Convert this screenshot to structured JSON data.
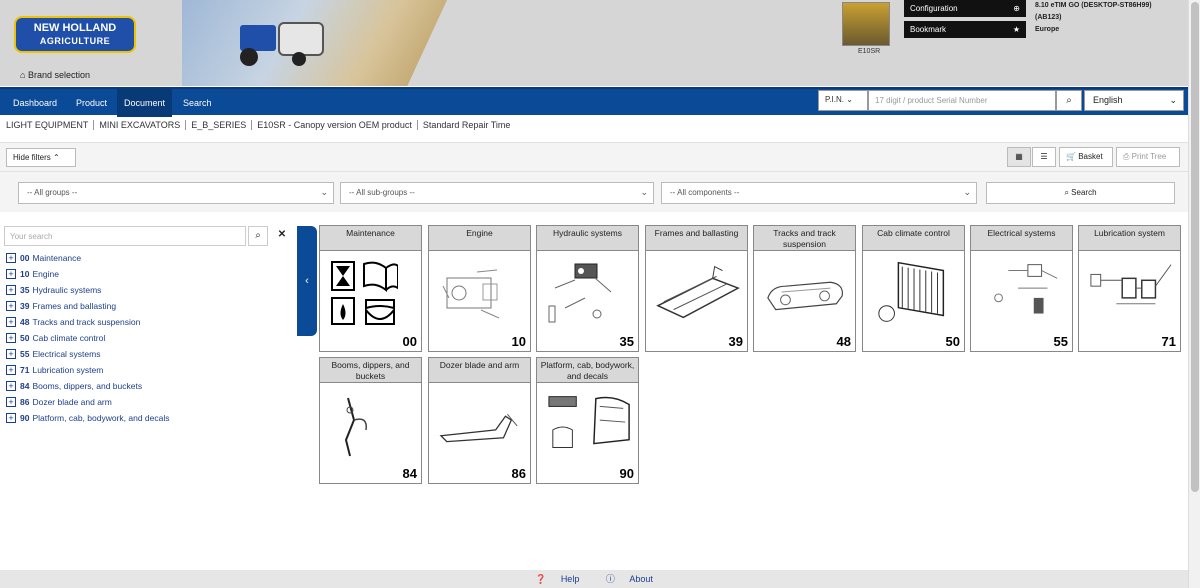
{
  "header": {
    "logo_line1": "NEW HOLLAND",
    "logo_line2": "AGRICULTURE",
    "brand_selection": "Brand selection",
    "machine_caption": "E10SR",
    "config_label": "Configuration",
    "bookmark_label": "Bookmark",
    "session_line1": "8.10 eTIM GO (DESKTOP-ST86H99)",
    "session_line2": "(AB123)",
    "session_line3": "Europe"
  },
  "nav": {
    "items": [
      {
        "label": "Dashboard"
      },
      {
        "label": "Product"
      },
      {
        "label": "Document"
      },
      {
        "label": "Search"
      }
    ],
    "pin_label": "P.I.N.",
    "serial_placeholder": "17 digit / product Serial Number",
    "language": "English"
  },
  "breadcrumb": [
    "LIGHT EQUIPMENT",
    "MINI EXCAVATORS",
    "E_B_SERIES",
    "E10SR - Canopy version OEM product",
    "Standard Repair Time"
  ],
  "toolbar": {
    "hide_filters": "Hide filters",
    "basket": "Basket",
    "print_tree": "Print Tree"
  },
  "filters": {
    "groups": "-- All groups --",
    "subgroups": "-- All sub-groups --",
    "components": "-- All components --",
    "search": "Search"
  },
  "tree": {
    "search_placeholder": "Your search",
    "items": [
      {
        "code": "00",
        "label": "Maintenance"
      },
      {
        "code": "10",
        "label": "Engine"
      },
      {
        "code": "35",
        "label": "Hydraulic systems"
      },
      {
        "code": "39",
        "label": "Frames and ballasting"
      },
      {
        "code": "48",
        "label": "Tracks and track suspension"
      },
      {
        "code": "50",
        "label": "Cab climate control"
      },
      {
        "code": "55",
        "label": "Electrical systems"
      },
      {
        "code": "71",
        "label": "Lubrication system"
      },
      {
        "code": "84",
        "label": "Booms, dippers, and buckets"
      },
      {
        "code": "86",
        "label": "Dozer blade and arm"
      },
      {
        "code": "90",
        "label": "Platform, cab, bodywork, and decals"
      }
    ]
  },
  "tiles": [
    {
      "title": "Maintenance",
      "num": "00"
    },
    {
      "title": "Engine",
      "num": "10"
    },
    {
      "title": "Hydraulic systems",
      "num": "35"
    },
    {
      "title": "Frames and ballasting",
      "num": "39"
    },
    {
      "title": "Tracks and track suspension",
      "num": "48"
    },
    {
      "title": "Cab climate control",
      "num": "50"
    },
    {
      "title": "Electrical systems",
      "num": "55"
    },
    {
      "title": "Lubrication system",
      "num": "71"
    },
    {
      "title": "Booms, dippers, and buckets",
      "num": "84"
    },
    {
      "title": "Dozer blade and arm",
      "num": "86"
    },
    {
      "title": "Platform, cab, bodywork, and decals",
      "num": "90"
    }
  ],
  "footer": {
    "help": "Help",
    "about": "About"
  },
  "colors": {
    "nav_blue": "#0a4a96",
    "link_blue": "#1c3f8a",
    "logo_yellow": "#f0c300"
  }
}
